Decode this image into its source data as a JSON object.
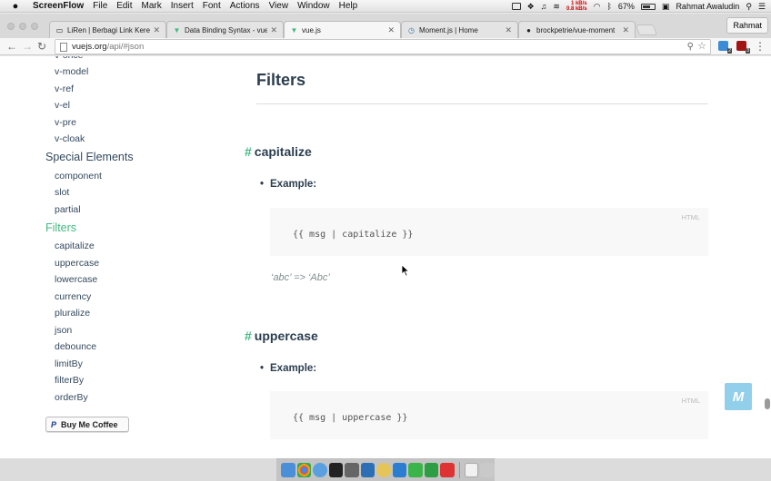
{
  "menubar": {
    "app_name": "ScreenFlow",
    "items": [
      "File",
      "Edit",
      "Mark",
      "Insert",
      "Font",
      "Actions",
      "View",
      "Window",
      "Help"
    ],
    "net_up": "1 kB/s",
    "net_down": "0.8 kB/s",
    "battery": "67%",
    "user": "Rahmat Awaludin",
    "battery_level": 0.67
  },
  "browser": {
    "tabs": [
      {
        "label": "LiRen | Berbagi Link Keren",
        "icon": "page-icon"
      },
      {
        "label": "Data Binding Syntax - vue.js",
        "icon": "vue-icon"
      },
      {
        "label": "vue.js",
        "icon": "vue-icon",
        "active": true
      },
      {
        "label": "Moment.js | Home",
        "icon": "clock-icon"
      },
      {
        "label": "brockpetrie/vue-moment",
        "icon": "github-icon"
      }
    ],
    "profile": "Rahmat",
    "url_host": "vuejs.org",
    "url_path": "/api/#json",
    "ext1_badge": "2",
    "ext2_badge": "3"
  },
  "sidebar": {
    "partial_top": "v-once",
    "directives": [
      "v-model",
      "v-ref",
      "v-el",
      "v-pre",
      "v-cloak"
    ],
    "special_title": "Special Elements",
    "special_items": [
      "component",
      "slot",
      "partial"
    ],
    "filters_title": "Filters",
    "filter_items": [
      "capitalize",
      "uppercase",
      "lowercase",
      "currency",
      "pluralize",
      "json",
      "debounce",
      "limitBy",
      "filterBy",
      "orderBy"
    ],
    "coffee_logo": "P",
    "coffee_label": "Buy Me Coffee"
  },
  "main": {
    "title": "Filters",
    "sections": [
      {
        "hash": "#",
        "heading": "capitalize",
        "bullet": "Example:",
        "lang": "HTML",
        "code": "{{ msg | capitalize }}",
        "output": "‘abc’ => ‘Abc’"
      },
      {
        "hash": "#",
        "heading": "uppercase",
        "bullet": "Example:",
        "lang": "HTML",
        "code": "{{ msg | uppercase }}"
      }
    ]
  },
  "watermark": "M",
  "colors": {
    "accent": "#42b983",
    "text": "#2c3e50",
    "sidebar_text": "#34495e",
    "code_bg": "#f8f8f8"
  }
}
